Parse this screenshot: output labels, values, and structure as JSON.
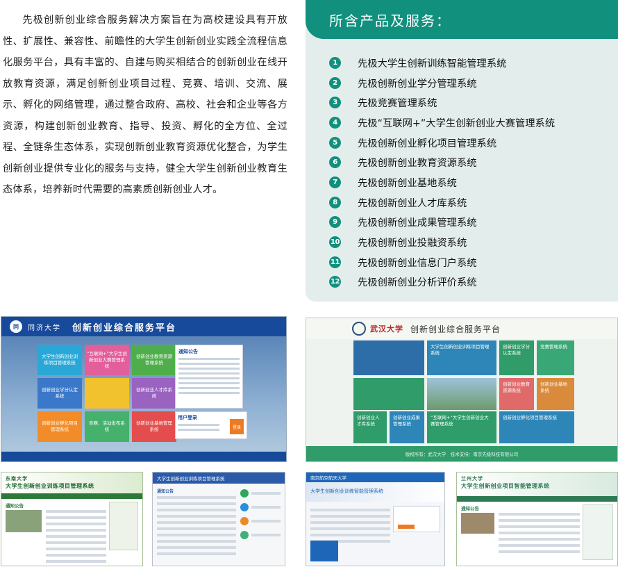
{
  "intro": {
    "text": "先极创新创业综合服务解决方案旨在为高校建设具有开放性、扩展性、兼容性、前瞻性的大学生创新创业实践全流程信息化服务平台，具有丰富的、自建与购买相结合的创新创业在线开放教育资源，满足创新创业项目过程、竞赛、培训、交流、展示、孵化的网络管理，通过整合政府、高校、社会和企业等各方资源，构建创新创业教育、指导、投资、孵化的全方位、全过程、全链条生态体系，实现创新创业教育资源优化整合，为学生创新创业提供专业化的服务与支持，健全大学生创新创业教育生态体系，培养新时代需要的高素质创新创业人才。"
  },
  "products": {
    "title": "所含产品及服务：",
    "items": [
      {
        "num": "1",
        "name": "先极大学生创新训练智能管理系统"
      },
      {
        "num": "2",
        "name": "先极创新创业学分管理系统"
      },
      {
        "num": "3",
        "name": "先极竞赛管理系统"
      },
      {
        "num": "4",
        "name": "先极“互联网+”大学生创新创业大赛管理系统"
      },
      {
        "num": "5",
        "name": "先极创新创业孵化项目管理系统"
      },
      {
        "num": "6",
        "name": "先极创新创业教育资源系统"
      },
      {
        "num": "7",
        "name": "先极创新创业基地系统"
      },
      {
        "num": "8",
        "name": "先极创新创业人才库系统"
      },
      {
        "num": "9",
        "name": "先极创新创业成果管理系统"
      },
      {
        "num": "10",
        "name": "先极创新创业投融资系统"
      },
      {
        "num": "11",
        "name": "先极创新创业信息门户系统"
      },
      {
        "num": "12",
        "name": "先极创新创业分析评价系统"
      }
    ]
  },
  "shot1": {
    "logo": "同",
    "university": "同济大学",
    "title": "创新创业综合服务平台",
    "tiles": [
      {
        "label": "大学生创新创业训练项目管理系统",
        "color": "#29a8d8"
      },
      {
        "label": "“互联网+”大学生创新创业大赛管理系统",
        "color": "#e25f9c"
      },
      {
        "label": "创新创业教育资源管理系统",
        "color": "#4fae4b"
      },
      {
        "label": "创新创业学分认定系统",
        "color": "#3b78c9"
      },
      {
        "label": "",
        "color": "#f2c12e"
      },
      {
        "label": "创新创业人才库系统",
        "color": "#9a63c0"
      },
      {
        "label": "创新创业孵化项目管理系统",
        "color": "#f28c28"
      },
      {
        "label": "竞赛、活动发布系统",
        "color": "#46b06d"
      },
      {
        "label": "创新创业基地管理系统",
        "color": "#e44d4d"
      }
    ],
    "news_title": "通知公告",
    "login_title": "用户登录",
    "login_button": "登录"
  },
  "shot2": {
    "university": "武汉大学",
    "title": "创新创业综合服务平台",
    "boxes": [
      {
        "label": "大学生创新创业训练项目管理系统",
        "color": "#2e86b8"
      },
      {
        "label": "创新创业学分认定系统",
        "color": "#2f9c6a"
      },
      {
        "label": "竞赛管理系统",
        "color": "#3aa876"
      },
      {
        "label": "创新创业教育资源系统",
        "color": "#e06a6a"
      },
      {
        "label": "创新创业基地系统",
        "color": "#d98a3a"
      },
      {
        "label": "创新创业人才库系统",
        "color": "#2f9c6a"
      },
      {
        "label": "创新创业成果管理系统",
        "color": "#2e86b8"
      },
      {
        "label": "“互联网+”大学生创新创业大赛管理系统",
        "color": "#2f9c6a"
      },
      {
        "label": "创新创业孵化项目管理系统",
        "color": "#2e86b8"
      }
    ],
    "footer": "版权所有：武汉大学　技术支持：南京先极科技有限公司"
  },
  "shot3": {
    "university": "东南大学",
    "title": "大学生创新创业训练项目管理系统",
    "section": "通知公告"
  },
  "shot4": {
    "title": "大学生创新创业训练项目管理系统",
    "section": "通知公告"
  },
  "shot5": {
    "university": "南京航空航天大学",
    "title": "大学生创新创业训练智能管理系统"
  },
  "shot6": {
    "university": "兰州大学",
    "title": "大学生创新创业项目智能管理系统",
    "section": "通知公告"
  }
}
